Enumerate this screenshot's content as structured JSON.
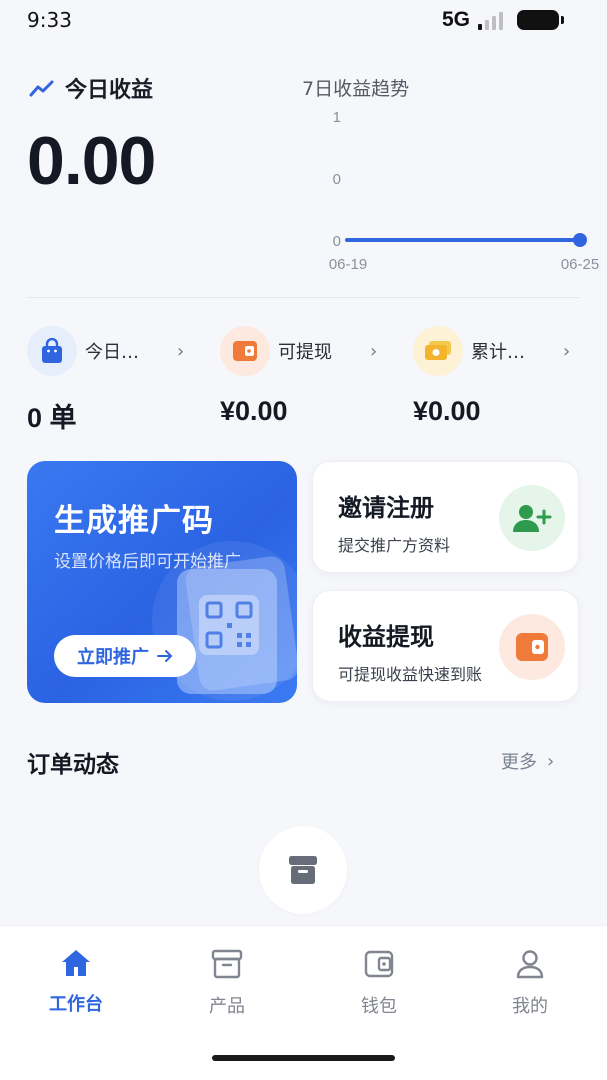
{
  "status_bar": {
    "time": "9:33",
    "network": "5G"
  },
  "earnings": {
    "title": "今日收益",
    "amount": "0.00"
  },
  "trend": {
    "title": "7日收益趋势",
    "y_ticks": [
      "1",
      "0",
      "0"
    ],
    "x_start": "06-19",
    "x_end": "06-25"
  },
  "stats": [
    {
      "label": "今日…",
      "value": "0 单",
      "icon": "shopping-bag-icon",
      "color": "#2f66e0"
    },
    {
      "label": "可提现",
      "value": "¥0.00",
      "icon": "wallet-icon",
      "color": "#f07a3a"
    },
    {
      "label": "累计…",
      "value": "¥0.00",
      "icon": "cash-icon",
      "color": "#f2b42c"
    }
  ],
  "promo": {
    "title": "生成推广码",
    "subtitle": "设置价格后即可开始推广",
    "button": "立即推广"
  },
  "cards": [
    {
      "title": "邀请注册",
      "subtitle": "提交推广方资料"
    },
    {
      "title": "收益提现",
      "subtitle": "可提现收益快速到账"
    }
  ],
  "orders": {
    "title": "订单动态",
    "more": "更多"
  },
  "tabs": [
    {
      "label": "工作台",
      "icon": "home-icon",
      "active": true
    },
    {
      "label": "产品",
      "icon": "archive-icon",
      "active": false
    },
    {
      "label": "钱包",
      "icon": "wallet-icon",
      "active": false
    },
    {
      "label": "我的",
      "icon": "user-icon",
      "active": false
    }
  ],
  "colors": {
    "accent": "#2f66e0",
    "background": "#f6f7fb"
  }
}
